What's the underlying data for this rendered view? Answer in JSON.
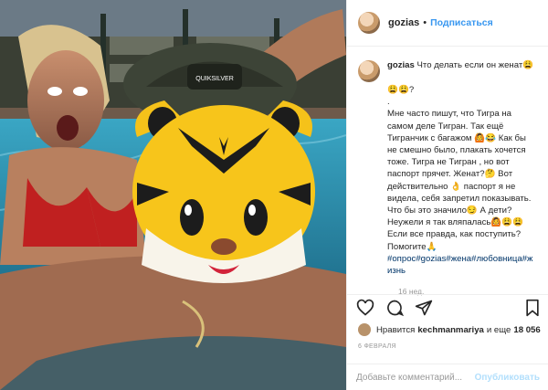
{
  "post": {
    "username": "gozias",
    "follow_separator": "•",
    "follow_label": "Подписаться",
    "caption_username": "gozias",
    "caption_lines": [
      "Что делать если он женат😩",
      "😩😩?",
      ".",
      "Мне часто пишут, что Тигра на",
      "самом деле Тигран. Так ещё",
      "Тигранчик с багажом 🙆😂 Как бы",
      "не смешно было, плакать хочется",
      "тоже. Тигра не Тигран , но вот",
      "паспорт прячет. Женат?🤔 Вот",
      "действительно 👌 паспорт я не",
      "видела, себя запретил показывать.",
      "Что бы это значило😏 А дети?",
      "Неужели я так вляпалась🙆😩😩",
      "Если все правда, как поступить?",
      "Помогите🙏"
    ],
    "hashtags_line1": "#опрос#gozias#жена#любовница#ж",
    "hashtags_line2": "изнь",
    "time_ago": "16 нед.",
    "likes_prefix": "Нравится",
    "likes_user": "kechmanmariya",
    "likes_and": "и еще",
    "likes_count": "18 056",
    "date": "6 ФЕВРАЛЯ",
    "comment_placeholder": "Добавьте комментарий...",
    "publish_label": "Опубликовать"
  },
  "photo": {
    "cap_brand": "QUIKSILVER"
  },
  "icons": [
    "heart-icon",
    "comment-icon",
    "share-icon",
    "bookmark-icon",
    "tiger-emoji"
  ],
  "colors": {
    "accent": "#3897f0",
    "hashtag": "#003569",
    "muted": "#999999",
    "publish_disabled": "#b2dffc"
  }
}
